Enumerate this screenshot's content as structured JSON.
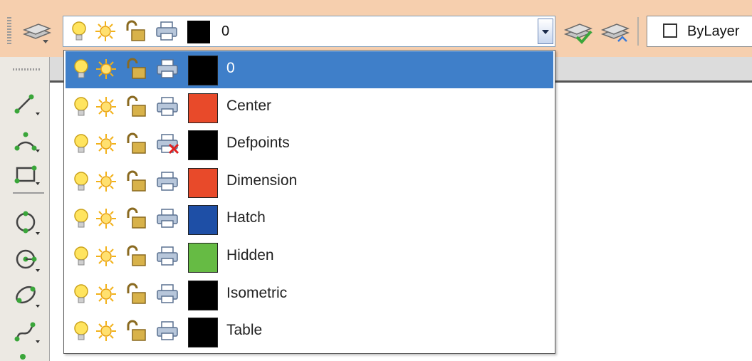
{
  "toolbar": {
    "current_layer": "0",
    "linetype_value": "ByLayer",
    "icons": [
      "layer-properties-icon",
      "make-current-icon",
      "layer-previous-icon"
    ]
  },
  "layers": [
    {
      "name": "0",
      "color": "#000000",
      "plot": "plottable",
      "selected": true
    },
    {
      "name": "Center",
      "color": "#e84a2a",
      "plot": "plottable",
      "selected": false
    },
    {
      "name": "Defpoints",
      "color": "#000000",
      "plot": "no-plot",
      "selected": false
    },
    {
      "name": "Dimension",
      "color": "#e84a2a",
      "plot": "plottable",
      "selected": false
    },
    {
      "name": "Hatch",
      "color": "#1e4fa6",
      "plot": "plottable",
      "selected": false
    },
    {
      "name": "Hidden",
      "color": "#66bb44",
      "plot": "plottable",
      "selected": false
    },
    {
      "name": "Isometric",
      "color": "#000000",
      "plot": "plottable",
      "selected": false
    },
    {
      "name": "Table",
      "color": "#000000",
      "plot": "plottable",
      "selected": false
    }
  ],
  "left_tools": [
    "line-icon",
    "arc-icon",
    "rectangle-icon",
    "circle-icon",
    "revolve-icon",
    "ellipse-icon",
    "spline-icon"
  ],
  "colors": {
    "selection": "#3f7fc9",
    "background": "#f6cfae"
  }
}
